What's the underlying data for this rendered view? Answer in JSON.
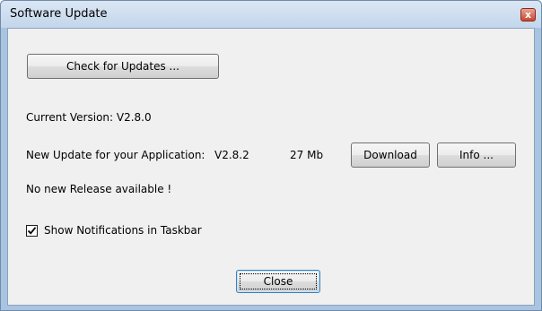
{
  "window": {
    "title": "Software Update",
    "close_glyph": "x",
    "colors": {
      "frame": "#a9c4e0",
      "client": "#f0f0f0",
      "close_button": "#c9462f"
    }
  },
  "buttons": {
    "check_updates": "Check for Updates ...",
    "download": "Download",
    "info": "Info ...",
    "close": "Close"
  },
  "info": {
    "current_version": "Current Version: V2.8.0",
    "new_update_label": "New Update for your Application:",
    "new_version": "V2.8.2",
    "size": "27 Mb",
    "no_release": "No new Release available !"
  },
  "options": {
    "show_notifications": {
      "label": "Show Notifications in Taskbar",
      "checked": true
    }
  },
  "icons": {
    "close": "close-icon",
    "check": "checkmark-icon"
  }
}
